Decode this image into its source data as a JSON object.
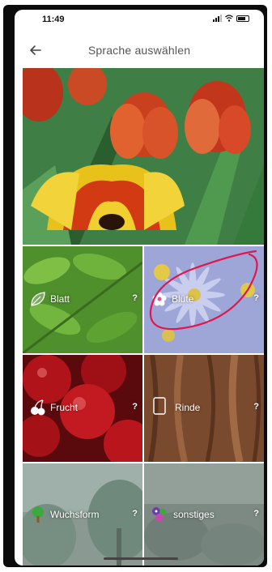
{
  "status_bar": {
    "time": "11:49"
  },
  "header": {
    "title": "Sprache auswählen"
  },
  "icons": {
    "back": "back-arrow-icon"
  },
  "categories": [
    {
      "label": "Blatt",
      "help": "?",
      "icon": "leaf-icon"
    },
    {
      "label": "Blüte",
      "help": "?",
      "icon": "flower-icon"
    },
    {
      "label": "Frucht",
      "help": "?",
      "icon": "cherry-icon"
    },
    {
      "label": "Rinde",
      "help": "?",
      "icon": "bark-icon"
    },
    {
      "label": "Wuchsform",
      "help": "?",
      "icon": "tree-icon"
    },
    {
      "label": "sonstiges",
      "help": "?",
      "icon": "misc-icon"
    }
  ],
  "colors": {
    "annotation": "#e0164e",
    "frame": "#0b0b0b"
  }
}
